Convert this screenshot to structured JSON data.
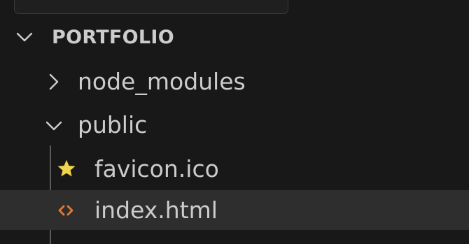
{
  "explorer": {
    "section_title": "PORTFOLIO",
    "items": [
      {
        "label": "node_modules",
        "type": "folder",
        "expanded": false,
        "icon": "chevron-right-icon"
      },
      {
        "label": "public",
        "type": "folder",
        "expanded": true,
        "icon": "chevron-down-icon"
      },
      {
        "label": "favicon.ico",
        "type": "file",
        "icon": "star-icon",
        "icon_color": "#f0d34f"
      },
      {
        "label": "index.html",
        "type": "file",
        "icon": "html-code-icon",
        "icon_color": "#e37933",
        "selected": true
      }
    ]
  },
  "colors": {
    "background": "#181818",
    "selected_row": "#2e2e2e",
    "text": "#cccccc"
  }
}
